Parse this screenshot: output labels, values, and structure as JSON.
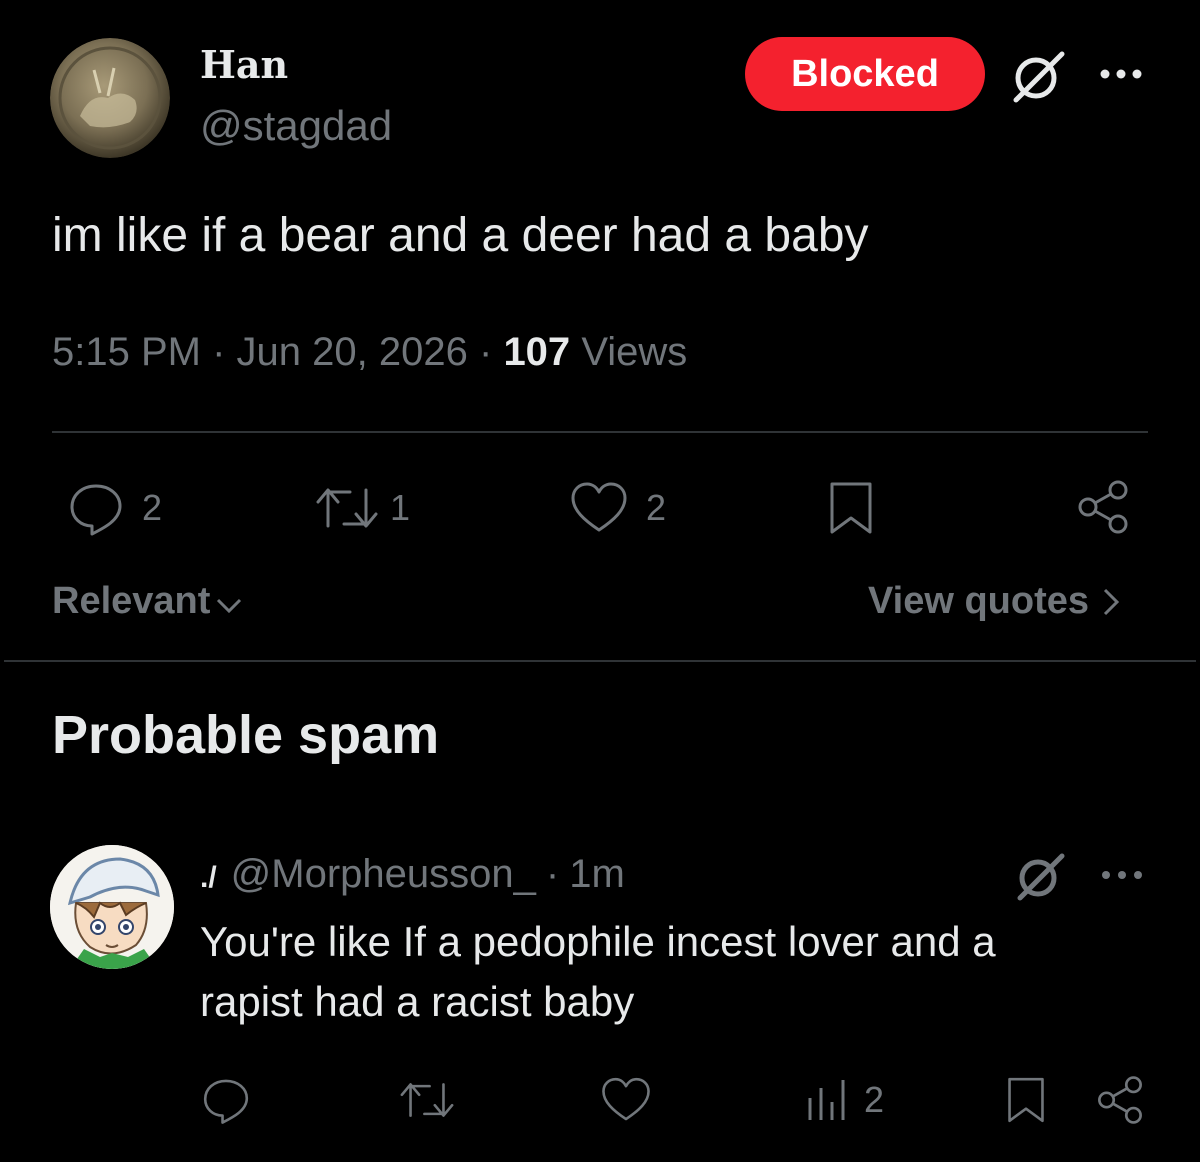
{
  "tweet": {
    "author_name": "Han",
    "author_handle": "@stagdad",
    "blocked_label": "Blocked",
    "text": "im like if a bear and a deer had a baby",
    "time": "5:15 PM",
    "date": "Jun 20, 2026",
    "views_count": "107",
    "views_label": "Views",
    "replies": "2",
    "reposts": "1",
    "likes": "2",
    "separator": "·"
  },
  "sort": {
    "label": "Relevant",
    "view_quotes": "View quotes"
  },
  "section": {
    "title": "Probable spam"
  },
  "reply": {
    "prefix": "./",
    "handle": "@Morpheusson_",
    "time": "1m",
    "text_line1": "You're like If a pedophile incest lover and a",
    "text_line2": "rapist had a racist baby",
    "views": "2"
  },
  "colors": {
    "blocked": "#f4212e",
    "muted": "#71767b",
    "text": "#e7e9ea"
  },
  "icons": [
    "grok-icon",
    "more-icon",
    "reply-icon",
    "repost-icon",
    "like-icon",
    "bookmark-icon",
    "share-icon",
    "views-icon",
    "chevron-down-icon",
    "chevron-right-icon"
  ]
}
